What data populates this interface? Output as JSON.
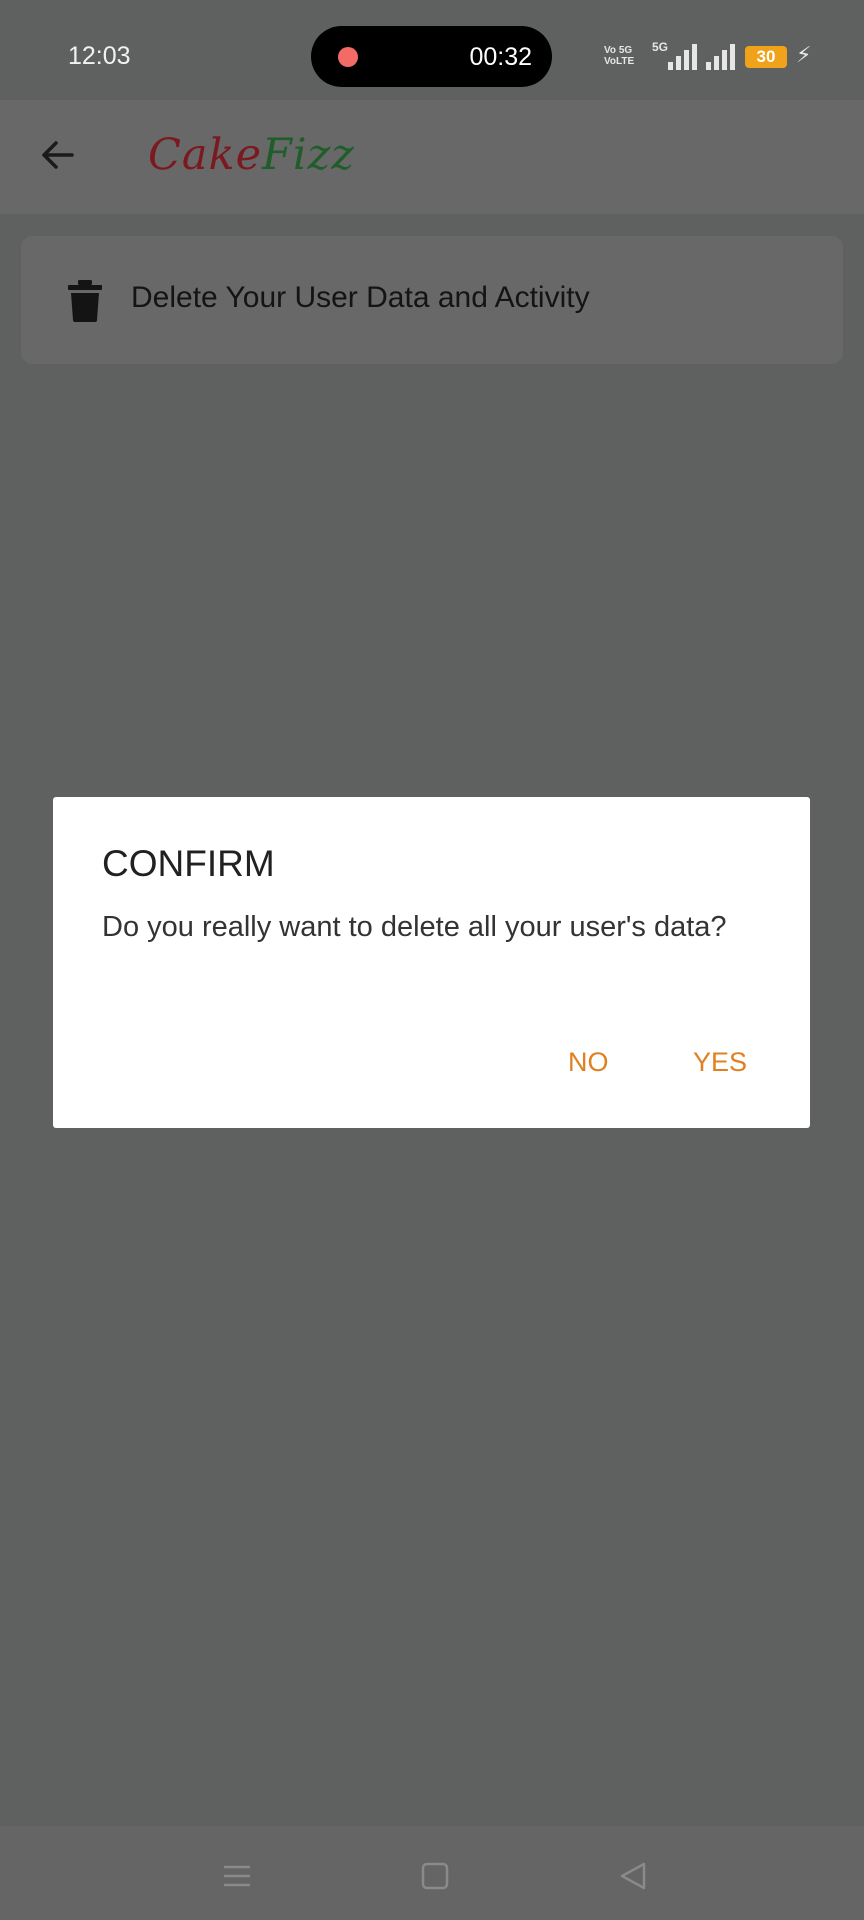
{
  "status_bar": {
    "time": "12:03",
    "recording_timer": "00:32",
    "network_top": "Vo 5G",
    "network_bottom": "VoLTE",
    "network_5g": "5G",
    "battery": "30"
  },
  "app_bar": {
    "logo_part1": "Cake",
    "logo_part2": "Fizz",
    "brand_colors": {
      "cake": "#7a1a20",
      "fizz": "#1f5e2a"
    }
  },
  "settings": {
    "delete_label": "Delete Your User Data and Activity"
  },
  "dialog": {
    "title": "CONFIRM",
    "message": "Do you really want to delete all your user's data?",
    "no_label": "NO",
    "yes_label": "YES",
    "accent_color": "#e08020"
  },
  "nav_bar": {
    "icons": [
      "menu-icon",
      "home-icon",
      "back-icon"
    ]
  }
}
